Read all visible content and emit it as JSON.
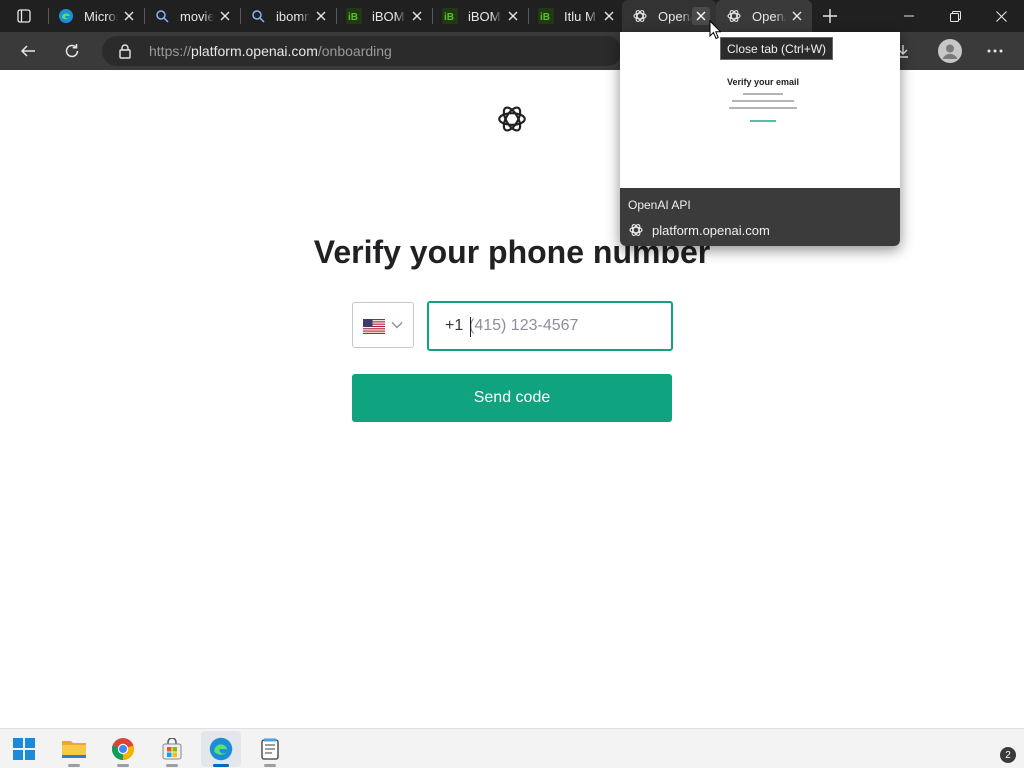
{
  "browser": {
    "tabs": [
      {
        "title": "Microsoft Edge",
        "icon": "edge-icon"
      },
      {
        "title": "movies",
        "icon": "search-icon"
      },
      {
        "title": "ibomma",
        "icon": "search-icon"
      },
      {
        "title": "iBOMMA",
        "icon": "ibomma-icon"
      },
      {
        "title": "iBOMMA",
        "icon": "ibomma-icon"
      },
      {
        "title": "Itlu M",
        "icon": "ibomma-icon"
      },
      {
        "title": "OpenAI API",
        "icon": "openai-icon"
      },
      {
        "title": "OpenAI API",
        "icon": "openai-icon"
      }
    ],
    "address": {
      "scheme": "https://",
      "host": "platform.openai.com",
      "path": "/onboarding"
    }
  },
  "page": {
    "heading": "Verify your phone number",
    "country_flag": "us-flag-icon",
    "dial_code": "+1",
    "phone_placeholder": "(415) 123-4567",
    "phone_value": "",
    "send_label": "Send code"
  },
  "hover_card": {
    "tooltip": "Close tab (Ctrl+W)",
    "preview_title": "Verify your email",
    "title": "OpenAI API",
    "url": "platform.openai.com"
  },
  "taskbar": {
    "apps": [
      "start-icon",
      "file-explorer-icon",
      "chrome-icon",
      "store-icon",
      "edge-icon",
      "notepad-icon"
    ],
    "notification_count": "2"
  },
  "colors": {
    "accent": "#10a37f",
    "titlebar": "#202020",
    "toolbar": "#3a3a3a"
  }
}
